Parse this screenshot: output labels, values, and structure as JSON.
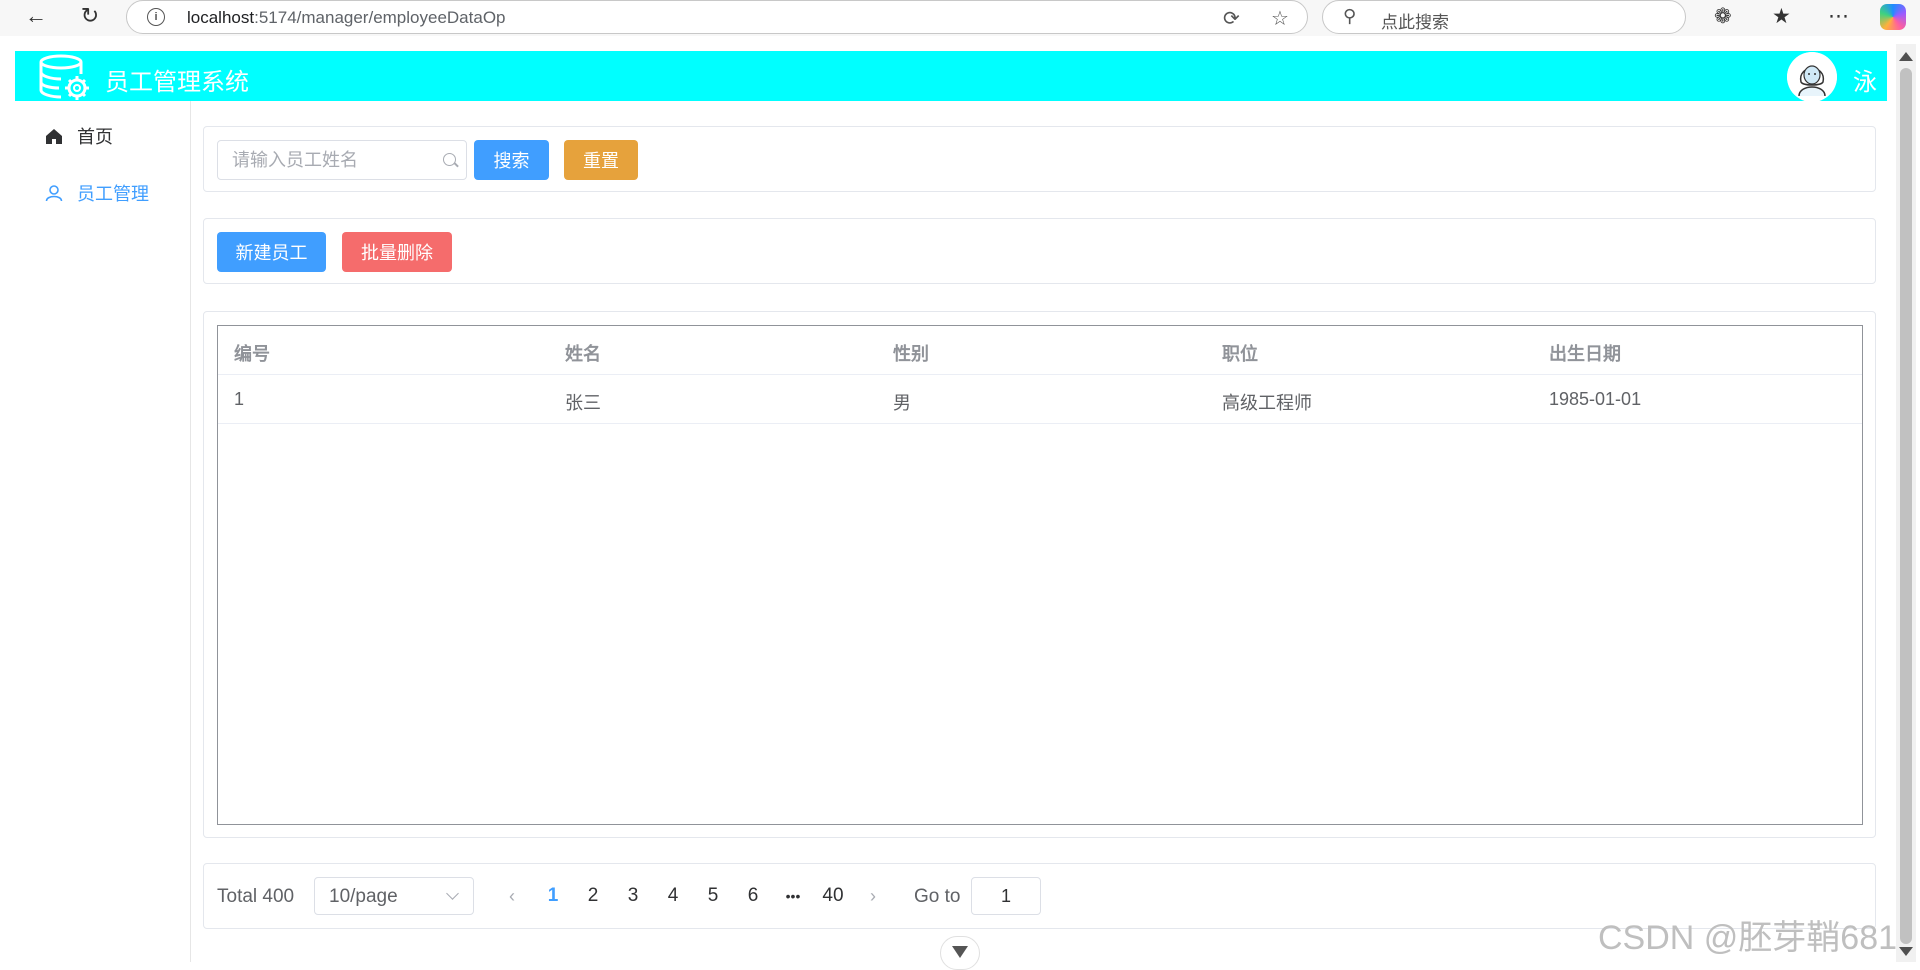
{
  "browser": {
    "url_host": "localhost",
    "url_path": ":5174/manager/employeeDataOp",
    "search_placeholder": "点此搜索"
  },
  "header": {
    "title": "员工管理系统",
    "user_name": "泳",
    "bg_color": "#00ffff"
  },
  "sidebar": {
    "items": [
      {
        "label": "首页",
        "icon": "home-icon"
      },
      {
        "label": "员工管理",
        "icon": "user-icon",
        "active": true
      }
    ]
  },
  "search": {
    "placeholder": "请输入员工姓名",
    "value": "",
    "search_label": "搜索",
    "reset_label": "重置"
  },
  "actions": {
    "add_label": "新建员工",
    "batch_delete_label": "批量删除"
  },
  "table": {
    "columns": [
      "编号",
      "姓名",
      "性别",
      "职位",
      "出生日期"
    ],
    "rows": [
      [
        "1",
        "张三",
        "男",
        "高级工程师",
        "1985-01-01"
      ]
    ]
  },
  "pagination": {
    "total_label": "Total 400",
    "page_size": "10/page",
    "pages": [
      "1",
      "2",
      "3",
      "4",
      "5",
      "6",
      "•••",
      "40"
    ],
    "current": "1",
    "goto_label": "Go to",
    "goto_value": "1"
  },
  "watermark": "CSDN @胚芽鞘681",
  "colors": {
    "primary": "#409eff",
    "warning": "#e6a23c",
    "danger": "#f56c6c"
  }
}
